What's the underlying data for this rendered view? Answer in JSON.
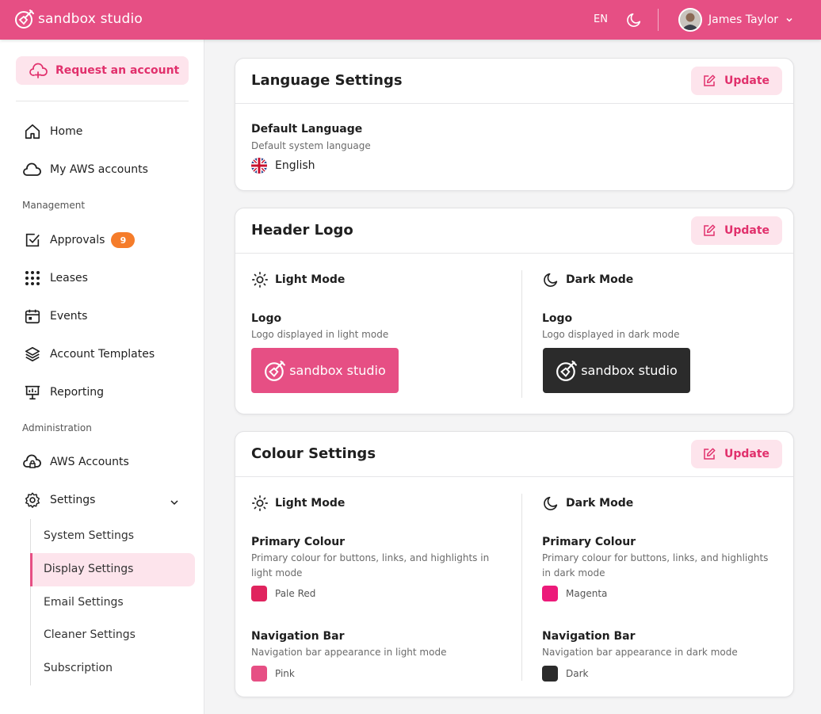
{
  "app": {
    "brand_name": "sandbox studio",
    "language_code": "EN",
    "user_name": "James Taylor",
    "accent": "#e64f84"
  },
  "sidebar": {
    "request_account": "Request an account",
    "items": [
      {
        "label": "Home",
        "icon": "home-icon"
      },
      {
        "label": "My AWS accounts",
        "icon": "cloud-icon"
      }
    ],
    "management_label": "Management",
    "management": [
      {
        "label": "Approvals",
        "icon": "checkbox-icon",
        "badge": "9"
      },
      {
        "label": "Leases",
        "icon": "grid-dots-icon"
      },
      {
        "label": "Events",
        "icon": "calendar-icon"
      },
      {
        "label": "Account Templates",
        "icon": "layers-icon"
      },
      {
        "label": "Reporting",
        "icon": "presentation-icon"
      }
    ],
    "administration_label": "Administration",
    "administration": [
      {
        "label": "AWS Accounts",
        "icon": "cloud-lock-icon"
      },
      {
        "label": "Settings",
        "icon": "gear-icon"
      }
    ],
    "settings_sub": [
      {
        "label": "System Settings"
      },
      {
        "label": "Display Settings",
        "active": true
      },
      {
        "label": "Email Settings"
      },
      {
        "label": "Cleaner Settings"
      },
      {
        "label": "Subscription"
      }
    ]
  },
  "language_card": {
    "title": "Language Settings",
    "update_label": "Update",
    "field_title": "Default Language",
    "field_desc": "Default system language",
    "value": "English"
  },
  "logo_card": {
    "title": "Header Logo",
    "update_label": "Update",
    "light": {
      "heading": "Light Mode",
      "field_title": "Logo",
      "field_desc": "Logo displayed in light mode",
      "bg": "#e64f84"
    },
    "dark": {
      "heading": "Dark Mode",
      "field_title": "Logo",
      "field_desc": "Logo displayed in dark mode",
      "bg": "#2b2b2b"
    }
  },
  "colour_card": {
    "title": "Colour Settings",
    "update_label": "Update",
    "light": {
      "heading": "Light Mode",
      "primary_title": "Primary Colour",
      "primary_desc": "Primary colour for buttons, links, and highlights in light mode",
      "primary_value": "Pale Red",
      "primary_color": "#e0245e",
      "nav_title": "Navigation Bar",
      "nav_desc": "Navigation bar appearance in light mode",
      "nav_value": "Pink",
      "nav_color": "#e64f84"
    },
    "dark": {
      "heading": "Dark Mode",
      "primary_title": "Primary Colour",
      "primary_desc": "Primary colour for buttons, links, and highlights in dark mode",
      "primary_value": "Magenta",
      "primary_color": "#ec1a7a",
      "nav_title": "Navigation Bar",
      "nav_desc": "Navigation bar appearance in dark mode",
      "nav_value": "Dark",
      "nav_color": "#2b2b2b"
    }
  }
}
